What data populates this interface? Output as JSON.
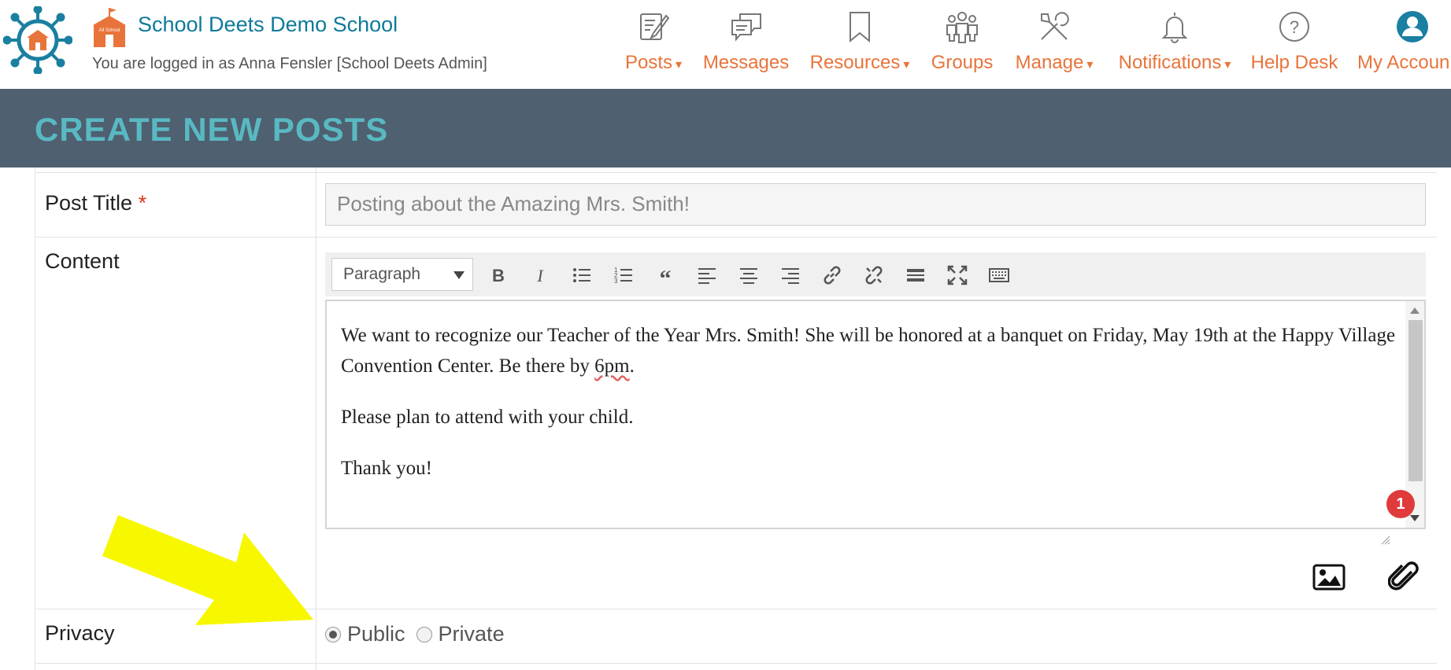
{
  "header": {
    "school_name": "School Deets Demo School",
    "logged_in_text": "You are logged in as Anna Fensler [School Deets Admin]",
    "school_icon_text": "All School"
  },
  "nav": {
    "items": [
      {
        "label": "Posts",
        "icon": "edit-icon",
        "dropdown": true
      },
      {
        "label": "Messages",
        "icon": "chat-bubbles-icon",
        "dropdown": false
      },
      {
        "label": "Resources",
        "icon": "bookmark-icon",
        "dropdown": true
      },
      {
        "label": "Groups",
        "icon": "people-icon",
        "dropdown": false
      },
      {
        "label": "Manage",
        "icon": "tools-icon",
        "dropdown": true
      },
      {
        "label": "Notifications",
        "icon": "bell-icon",
        "dropdown": true
      },
      {
        "label": "Help Desk",
        "icon": "question-icon",
        "dropdown": false
      },
      {
        "label": "My Accoun",
        "icon": "user-avatar-icon",
        "dropdown": false
      }
    ],
    "caret": "▾"
  },
  "page": {
    "title": "CREATE NEW POSTS"
  },
  "form": {
    "post_title_label": "Post Title",
    "required_marker": "*",
    "post_title_value": "Posting about the Amazing Mrs. Smith!",
    "content_label": "Content",
    "format_select": "Paragraph",
    "toolbar_icons": [
      "bold-icon",
      "italic-icon",
      "bullet-list-icon",
      "numbered-list-icon",
      "blockquote-icon",
      "align-left-icon",
      "align-center-icon",
      "align-right-icon",
      "link-icon",
      "unlink-icon",
      "horizontal-rule-icon",
      "fullscreen-icon",
      "keyboard-icon"
    ],
    "content": {
      "p1_a": "We want to recognize our Teacher of the Year Mrs. Smith! She will be honored at a banquet on Friday, May 19th at the Happy Village Convention Center. Be there by ",
      "p1_spell": "6pm",
      "p1_b": ".",
      "p2": "Please plan to attend with your child.",
      "p3": "Thank you!"
    },
    "badge_count": "1",
    "privacy_label": "Privacy",
    "privacy_options": [
      "Public",
      "Private"
    ],
    "privacy_selected": "Public"
  },
  "colors": {
    "accent_orange": "#e8743b",
    "school_blue": "#0e7a9a",
    "title_bar": "#4f6070",
    "title_text": "#59b9c2",
    "arrow_yellow": "#f7f700"
  }
}
